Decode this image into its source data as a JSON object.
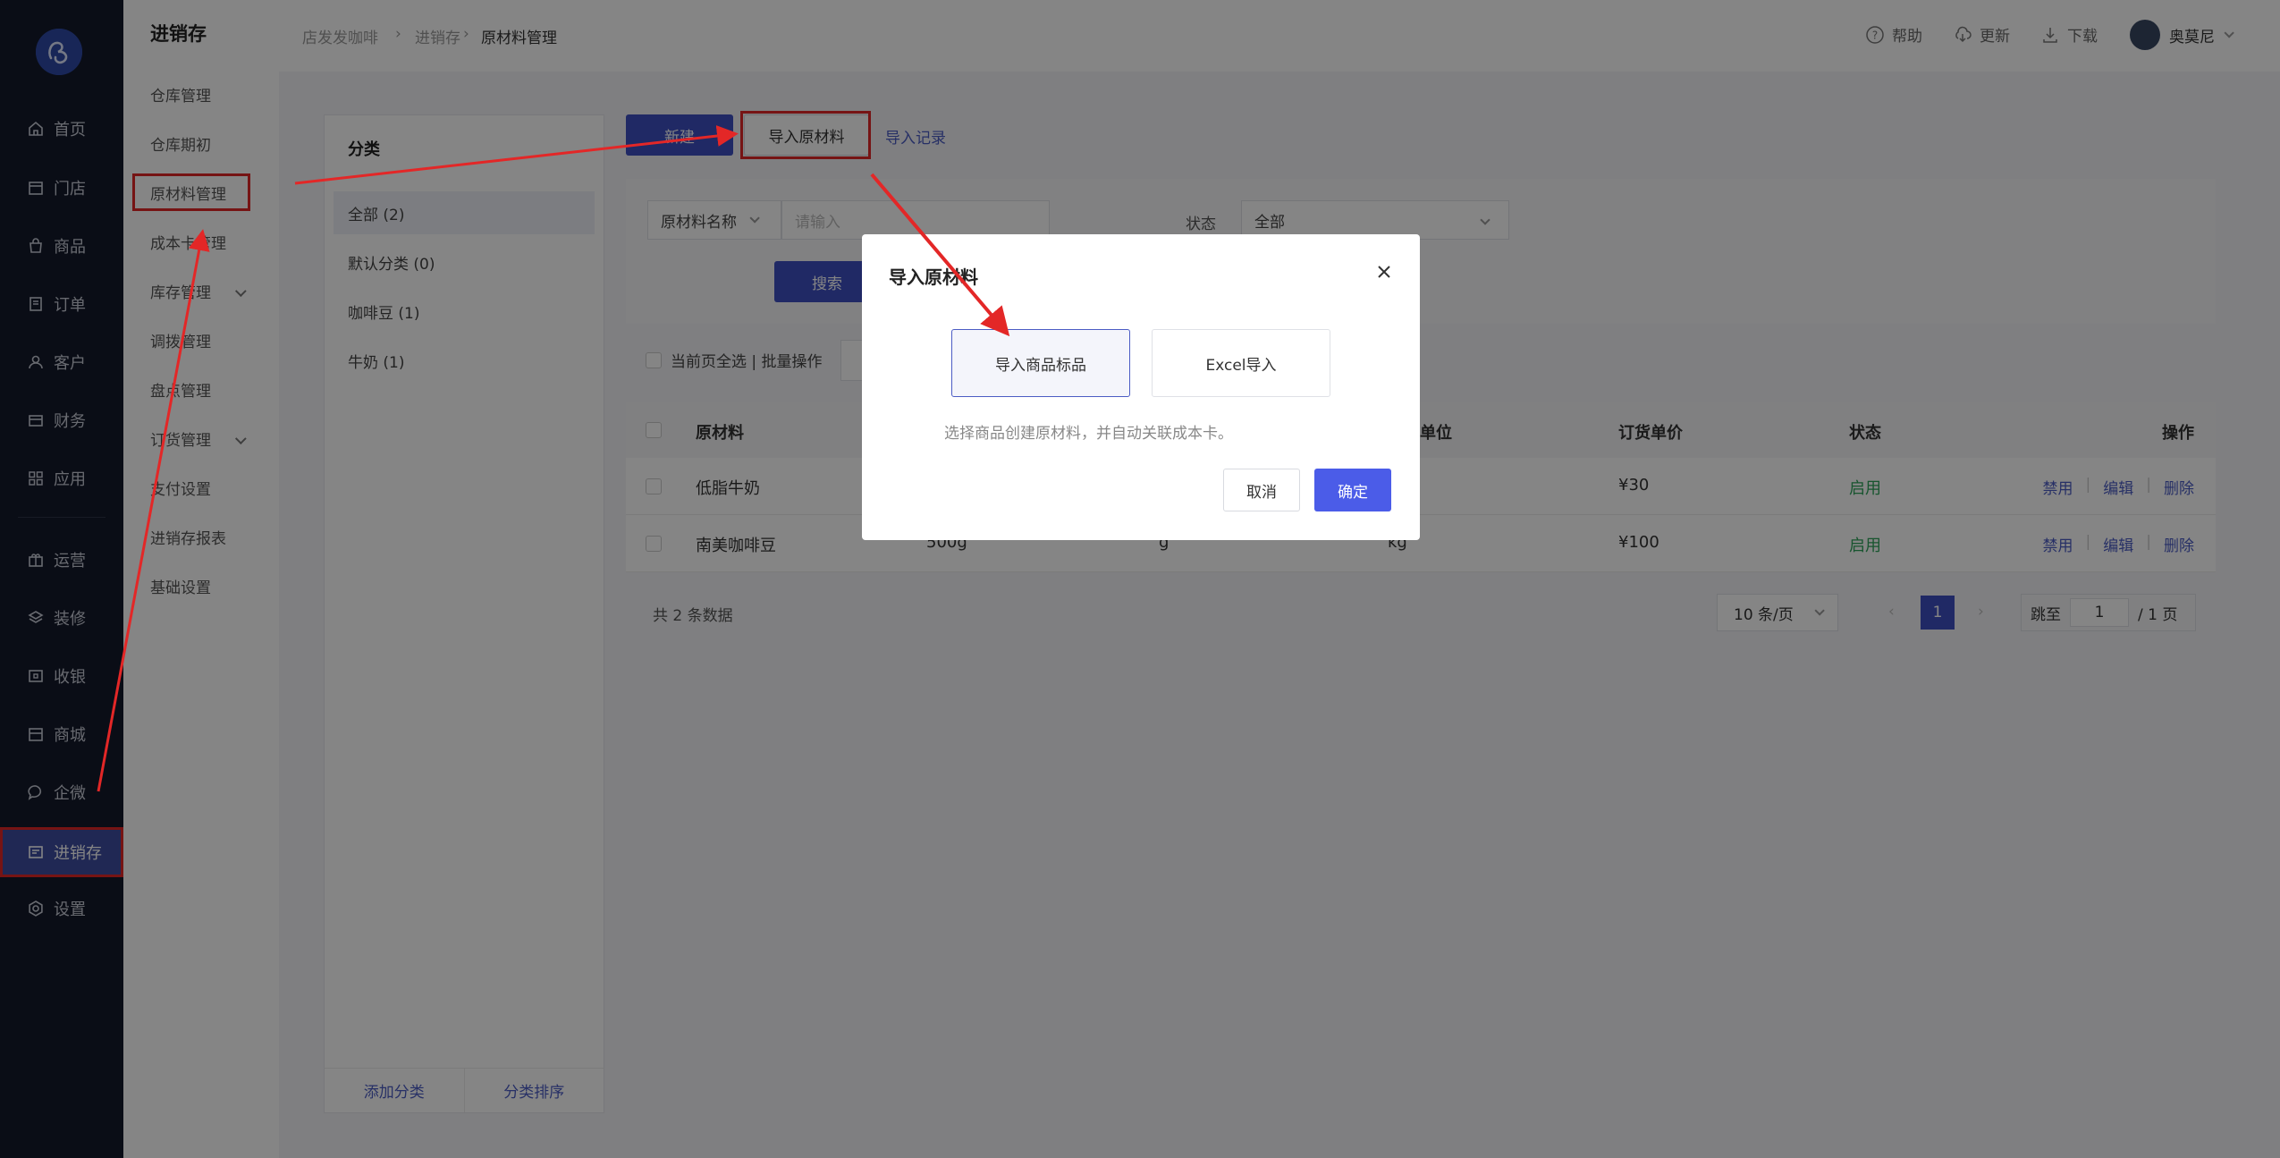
{
  "nav": {
    "items": [
      {
        "label": "首页",
        "icon": "home-icon"
      },
      {
        "label": "门店",
        "icon": "store-icon"
      },
      {
        "label": "商品",
        "icon": "bag-icon"
      },
      {
        "label": "订单",
        "icon": "order-icon"
      },
      {
        "label": "客户",
        "icon": "user-icon"
      },
      {
        "label": "财务",
        "icon": "card-icon"
      },
      {
        "label": "应用",
        "icon": "apps-icon"
      },
      {
        "label": "运营",
        "icon": "gift-icon"
      },
      {
        "label": "装修",
        "icon": "layers-icon"
      },
      {
        "label": "收银",
        "icon": "cashier-icon"
      },
      {
        "label": "商城",
        "icon": "mall-icon"
      },
      {
        "label": "企微",
        "icon": "chat-icon"
      },
      {
        "label": "进销存",
        "icon": "inventory-icon"
      },
      {
        "label": "设置",
        "icon": "settings-icon"
      }
    ]
  },
  "submenu": {
    "title": "进销存",
    "items": [
      "仓库管理",
      "仓库期初",
      "原材料管理",
      "成本卡管理",
      "库存管理",
      "调拨管理",
      "盘点管理",
      "订货管理",
      "支付设置",
      "进销存报表",
      "基础设置"
    ]
  },
  "header": {
    "breadcrumb": [
      "店发发咖啡",
      "进销存",
      "原材料管理"
    ],
    "help": "帮助",
    "update": "更新",
    "download": "下载",
    "user": "奥莫尼"
  },
  "category": {
    "title": "分类",
    "items": [
      "全部 (2)",
      "默认分类 (0)",
      "咖啡豆 (1)",
      "牛奶 (1)"
    ],
    "add": "添加分类",
    "sort": "分类排序"
  },
  "toolbar": {
    "new": "新建",
    "import": "导入原材料",
    "records": "导入记录"
  },
  "filter": {
    "name_select": "原材料名称",
    "name_placeholder": "请输入",
    "status_label": "状态",
    "status_value": "全部",
    "search": "搜索"
  },
  "batch": {
    "label": "当前页全选 | 批量操作"
  },
  "table": {
    "headers": [
      "原材料",
      "单位",
      "订货单价",
      "状态",
      "操作"
    ],
    "rows": [
      {
        "name": "低脂牛奶",
        "spec": "",
        "unit1": "",
        "unit2": "",
        "price": "¥30",
        "status": "启用"
      },
      {
        "name": "南美咖啡豆",
        "spec": "500g",
        "unit1": "g",
        "unit2": "kg",
        "price": "¥100",
        "status": "启用"
      }
    ],
    "ops": [
      "禁用",
      "编辑",
      "删除"
    ]
  },
  "pagination": {
    "total": "共 2 条数据",
    "size": "10 条/页",
    "current": "1",
    "jump": "跳至",
    "jump_value": "1",
    "pages": "/ 1 页"
  },
  "modal": {
    "title": "导入原材料",
    "option1": "导入商品标品",
    "option2": "Excel导入",
    "hint": "选择商品创建原材料，并自动关联成本卡。",
    "cancel": "取消",
    "ok": "确定"
  },
  "colors": {
    "accent": "#4b5cc4",
    "annotation": "#e32727",
    "nav_bg": "#14192b",
    "enabled": "#2ea35a"
  }
}
